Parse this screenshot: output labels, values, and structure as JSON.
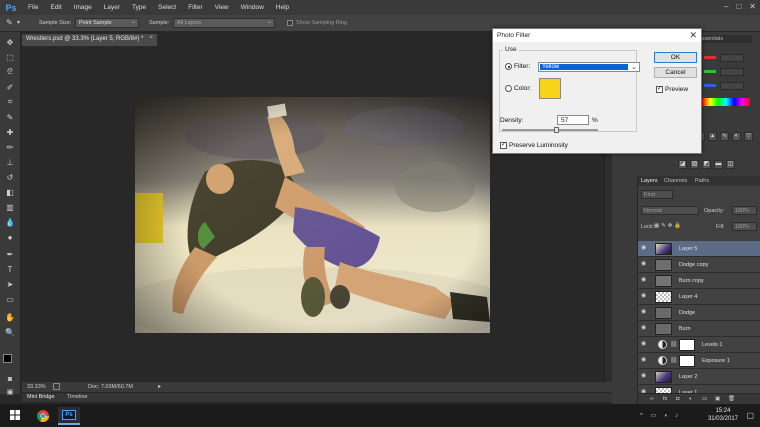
{
  "app": {
    "logo": "Ps",
    "menu": [
      "File",
      "Edit",
      "Image",
      "Layer",
      "Type",
      "Select",
      "Filter",
      "View",
      "Window",
      "Help"
    ],
    "window_controls": [
      "–",
      "□",
      "✕"
    ]
  },
  "options_bar": {
    "sample_size_label": "Sample Size:",
    "sample_size_value": "Point Sample",
    "sample_label": "Sample:",
    "sample_value": "All Layers",
    "sampling_ring_label": "Show Sampling Ring",
    "workspace": "Essentials"
  },
  "document": {
    "tab_title": "Wrestlers.psd @ 33.3% (Layer 5, RGB/8#) *",
    "tab_close": "×",
    "zoom": "33.33%",
    "doc_size": "Doc: 7.03M/60.7M"
  },
  "bottom_tabs": [
    "Mini Bridge",
    "Timeline"
  ],
  "dialog": {
    "title": "Photo Filter",
    "close": "✕",
    "use_label": "Use",
    "filter_label": "Filter:",
    "filter_value": "Yellow",
    "filter_selected": true,
    "color_label": "Color:",
    "color_value": "#f7d417",
    "density_label": "Density:",
    "density_value": "57",
    "density_unit": "%",
    "density_fraction": 0.57,
    "preserve_luminosity_label": "Preserve Luminosity",
    "preserve_luminosity": true,
    "ok_label": "OK",
    "cancel_label": "Cancel",
    "preview_label": "Preview",
    "preview": true
  },
  "layers_panel": {
    "tabs": [
      "Layers",
      "Channels",
      "Paths"
    ],
    "kind_label": "Kind",
    "blend_mode": "Normal",
    "opacity_label": "Opacity:",
    "opacity_value": "100%",
    "lock_label": "Lock:",
    "fill_label": "Fill:",
    "fill_value": "100%",
    "layers": [
      {
        "name": "Layer 5",
        "type": "photo",
        "active": true
      },
      {
        "name": "Dodge copy",
        "type": "gray",
        "active": false
      },
      {
        "name": "Burn copy",
        "type": "gray",
        "active": false
      },
      {
        "name": "Layer 4",
        "type": "checker",
        "active": false
      },
      {
        "name": "Dodge",
        "type": "gray",
        "active": false
      },
      {
        "name": "Burn",
        "type": "gray",
        "active": false
      },
      {
        "name": "Levels 1",
        "type": "adjustment",
        "active": false
      },
      {
        "name": "Exposure 1",
        "type": "adjustment",
        "active": false
      },
      {
        "name": "Layer 2",
        "type": "photo",
        "active": false
      },
      {
        "name": "Layer 1",
        "type": "checker",
        "active": false
      }
    ]
  },
  "taskbar": {
    "time": "15:24",
    "date": "31/03/2017",
    "ps_label": "Ps"
  },
  "colors": {
    "accent": "#0a64d6",
    "yellow_filter": "#f7d417",
    "active_layer": "#5c6c86",
    "background": "#282828"
  }
}
